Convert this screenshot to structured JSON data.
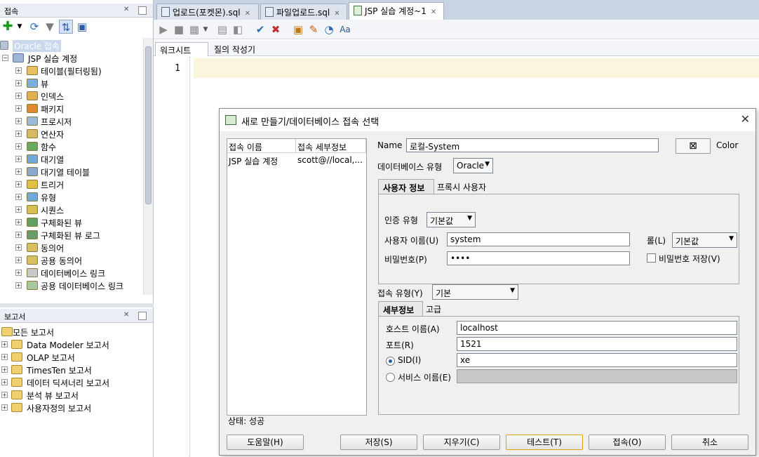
{
  "connections_panel": {
    "title": "접속",
    "oracle_root": "Oracle 접속",
    "connection": "JSP 실습 계정",
    "nodes": [
      "테이블(필터링됨)",
      "뷰",
      "인덱스",
      "패키지",
      "프로시저",
      "연산자",
      "함수",
      "대기열",
      "대기열 테이블",
      "트리거",
      "유형",
      "시퀀스",
      "구체화된 뷰",
      "구체화된 뷰 로그",
      "동의어",
      "공용 동의어",
      "데이터베이스 링크",
      "공용 데이터베이스 링크"
    ]
  },
  "reports_panel": {
    "title": "보고서",
    "items": [
      "모든 보고서",
      "Data Modeler 보고서",
      "OLAP 보고서",
      "TimesTen 보고서",
      "데이터 딕셔너리 보고서",
      "분석 뷰 보고서",
      "사용자정의 보고서"
    ]
  },
  "editor": {
    "tabs": [
      "업로드(포켓몬).sql",
      "파일업로드.sql",
      "JSP 실습 계정~1"
    ],
    "subtabs": [
      "워크시트",
      "질의 작성기"
    ],
    "line_number": "1"
  },
  "dialog": {
    "title": "새로 만들기/데이터베이스 접속 선택",
    "list_headers": [
      "접속 이름",
      "접속 세부정보"
    ],
    "list_rows": [
      [
        "JSP 실습 계정",
        "scott@//local,..."
      ]
    ],
    "status": "상태: 성공",
    "name_label": "Name",
    "name_value": "로컬-System",
    "color_label": "Color",
    "db_type_label": "데이터베이스 유형",
    "db_type_value": "Oracle",
    "user_tabs": [
      "사용자 정보",
      "프록시 사용자"
    ],
    "auth_label": "인증 유형",
    "auth_value": "기본값",
    "username_label": "사용자 이름(U)",
    "username_value": "system",
    "role_label": "롤(L)",
    "role_value": "기본값",
    "password_label": "비밀번호(P)",
    "password_value": "••••",
    "save_password_label": "비밀번호 저장(V)",
    "conn_type_label": "접속 유형(Y)",
    "conn_type_value": "기본",
    "detail_tabs": [
      "세부정보",
      "고급"
    ],
    "host_label": "호스트 이름(A)",
    "host_value": "localhost",
    "port_label": "포트(R)",
    "port_value": "1521",
    "sid_label": "SID(I)",
    "sid_value": "xe",
    "service_label": "서비스 이름(E)",
    "buttons": {
      "help": "도움말(H)",
      "save": "저장(S)",
      "clear": "지우기(C)",
      "test": "테스트(T)",
      "connect": "접속(O)",
      "cancel": "취소"
    }
  }
}
